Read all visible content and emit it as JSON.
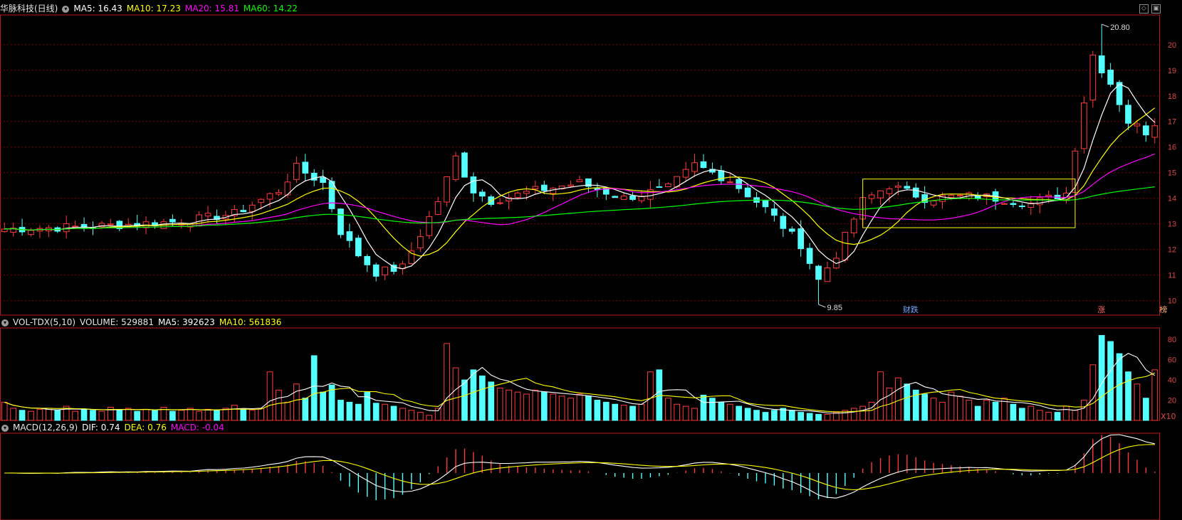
{
  "header": {
    "stock_name": "华脉科技(日线)",
    "ma5_label": "MA5: 16.43",
    "ma10_label": "MA10: 17.23",
    "ma20_label": "MA20: 15.81",
    "ma60_label": "MA60: 14.22"
  },
  "vol_header": {
    "title": "VOL-TDX(5,10)",
    "volume_label": "VOLUME: 529881",
    "ma5_label": "MA5: 392623",
    "ma10_label": "MA10: 561836",
    "unit": "X10"
  },
  "macd_header": {
    "title": "MACD(12,26,9)",
    "dif_label": "DIF: 0.74",
    "dea_label": "DEA: 0.76",
    "macd_label": "MACD: -0.04"
  },
  "annotations": {
    "high": "20.80",
    "low": "9.85",
    "marker_1": "财跌",
    "marker_2": "涨",
    "marker_3": "榜"
  },
  "colors": {
    "up": "#ff3b3b",
    "down": "#54ffff",
    "ma5": "#ffffff",
    "ma10": "#ffff00",
    "ma20": "#ff00ff",
    "ma60": "#00ff00",
    "grid": "#8b0000",
    "frame": "#c01818"
  },
  "chart_data": [
    {
      "type": "candlestick",
      "title": "华脉科技(日线)",
      "ylim": [
        9.6,
        20.8
      ],
      "y_ticks": [
        10,
        11,
        12,
        13,
        14,
        15,
        16,
        17,
        18,
        19,
        20
      ],
      "y_tick_labels": [
        "10",
        "11",
        "12",
        "13",
        "14",
        "15",
        "16",
        "17",
        "18",
        "19",
        "20"
      ],
      "high_marker": 20.8,
      "low_marker": 9.85,
      "anchors": [
        [
          0,
          12.8
        ],
        [
          10,
          12.9
        ],
        [
          20,
          13.1
        ],
        [
          26,
          13.4
        ],
        [
          31,
          14.3
        ],
        [
          33,
          15.2
        ],
        [
          36,
          14.6
        ],
        [
          38,
          12.7
        ],
        [
          40,
          11.8
        ],
        [
          42,
          11.1
        ],
        [
          45,
          11.3
        ],
        [
          49,
          13.9
        ],
        [
          51,
          15.6
        ],
        [
          53,
          14.3
        ],
        [
          55,
          13.9
        ],
        [
          60,
          14.3
        ],
        [
          65,
          14.6
        ],
        [
          70,
          14.0
        ],
        [
          75,
          14.4
        ],
        [
          78,
          15.3
        ],
        [
          82,
          14.7
        ],
        [
          86,
          13.6
        ],
        [
          90,
          12.2
        ],
        [
          92,
          10.8
        ],
        [
          94,
          11.8
        ],
        [
          97,
          13.9
        ],
        [
          100,
          14.5
        ],
        [
          104,
          14.0
        ],
        [
          110,
          14.1
        ],
        [
          116,
          13.8
        ],
        [
          120,
          14.2
        ],
        [
          123,
          19.6
        ],
        [
          125,
          18.5
        ],
        [
          127,
          17.0
        ],
        [
          129,
          16.6
        ],
        [
          131,
          17.3
        ]
      ],
      "ma5_last": 16.43,
      "ma10_last": 17.23,
      "ma20_last": 15.81,
      "ma60_last": 14.22,
      "consolidation_box": {
        "x_start": 97,
        "x_end": 121,
        "y_low": 12.85,
        "y_high": 14.75
      }
    },
    {
      "type": "bar",
      "title": "VOL-TDX(5,10)",
      "ylim": [
        0,
        90
      ],
      "y_ticks": [
        20,
        40,
        60,
        80
      ],
      "y_tick_labels": [
        "20",
        "40",
        "60",
        "80"
      ],
      "volume": [
        18,
        12,
        10,
        9,
        11,
        12,
        10,
        14,
        9,
        11,
        10,
        9,
        13,
        10,
        12,
        9,
        11,
        10,
        13,
        9,
        10,
        12,
        9,
        11,
        10,
        12,
        15,
        11,
        10,
        12,
        48,
        30,
        18,
        36,
        22,
        64,
        28,
        35,
        20,
        18,
        16,
        28,
        17,
        16,
        14,
        12,
        10,
        8,
        5,
        12,
        76,
        52,
        40,
        50,
        44,
        38,
        32,
        30,
        28,
        26,
        30,
        28,
        26,
        24,
        22,
        26,
        24,
        20,
        18,
        16,
        15,
        14,
        16,
        48,
        50,
        22,
        16,
        14,
        12,
        25,
        22,
        18,
        16,
        14,
        12,
        10,
        8,
        10,
        12,
        10,
        8,
        7,
        6,
        6,
        8,
        10,
        12,
        14,
        18,
        48,
        32,
        42,
        36,
        30,
        26,
        22,
        18,
        28,
        24,
        20,
        14,
        20,
        18,
        22,
        16,
        12,
        14,
        10,
        8,
        8,
        14,
        10,
        20,
        55,
        84,
        78,
        66,
        48,
        36,
        22,
        50
      ],
      "ma5_last": 392623,
      "ma10_last": 561836
    },
    {
      "type": "bar",
      "title": "MACD(12,26,9)",
      "dif": 0.74,
      "dea": 0.76,
      "macd": -0.04
    }
  ]
}
